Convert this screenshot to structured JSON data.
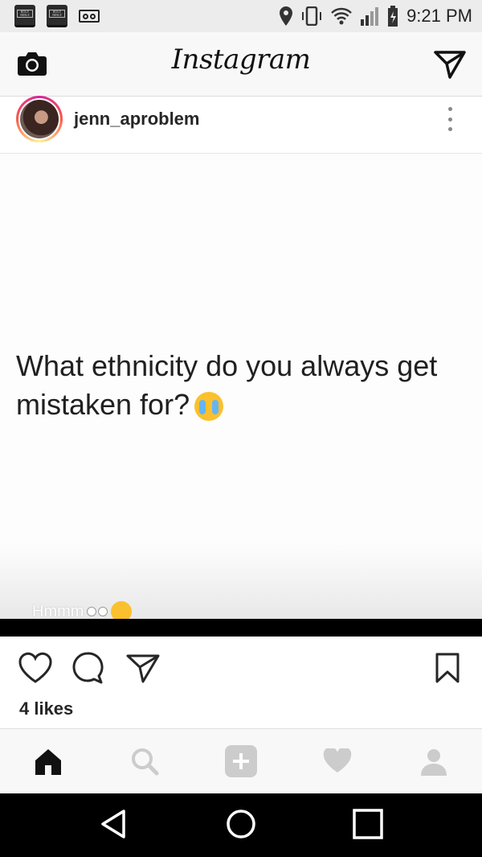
{
  "status_bar": {
    "left_icons": [
      "bible-app-icon",
      "bible-app-icon",
      "voicemail-icon"
    ],
    "bible_label": "HOLY BIBLE",
    "right_icons": [
      "location-icon",
      "vibrate-icon",
      "wifi-icon",
      "signal-icon",
      "battery-icon"
    ],
    "time": "9:21 PM"
  },
  "header": {
    "logo": "Instagram",
    "left_icon": "camera-icon",
    "right_icon": "direct-message-icon"
  },
  "post": {
    "username": "jenn_aproblem",
    "image_text": "What ethnicity do you always get mistaken for?",
    "image_emoji": "loudly-crying-face",
    "overlay_text": "Hmmm",
    "likes": "4 likes"
  },
  "tabs": [
    "home-icon",
    "search-icon",
    "add-icon",
    "heart-icon",
    "profile-icon"
  ],
  "colors": {
    "header_bg": "#f8f8f8",
    "text": "#262626",
    "inactive_tab": "#cccccc"
  }
}
